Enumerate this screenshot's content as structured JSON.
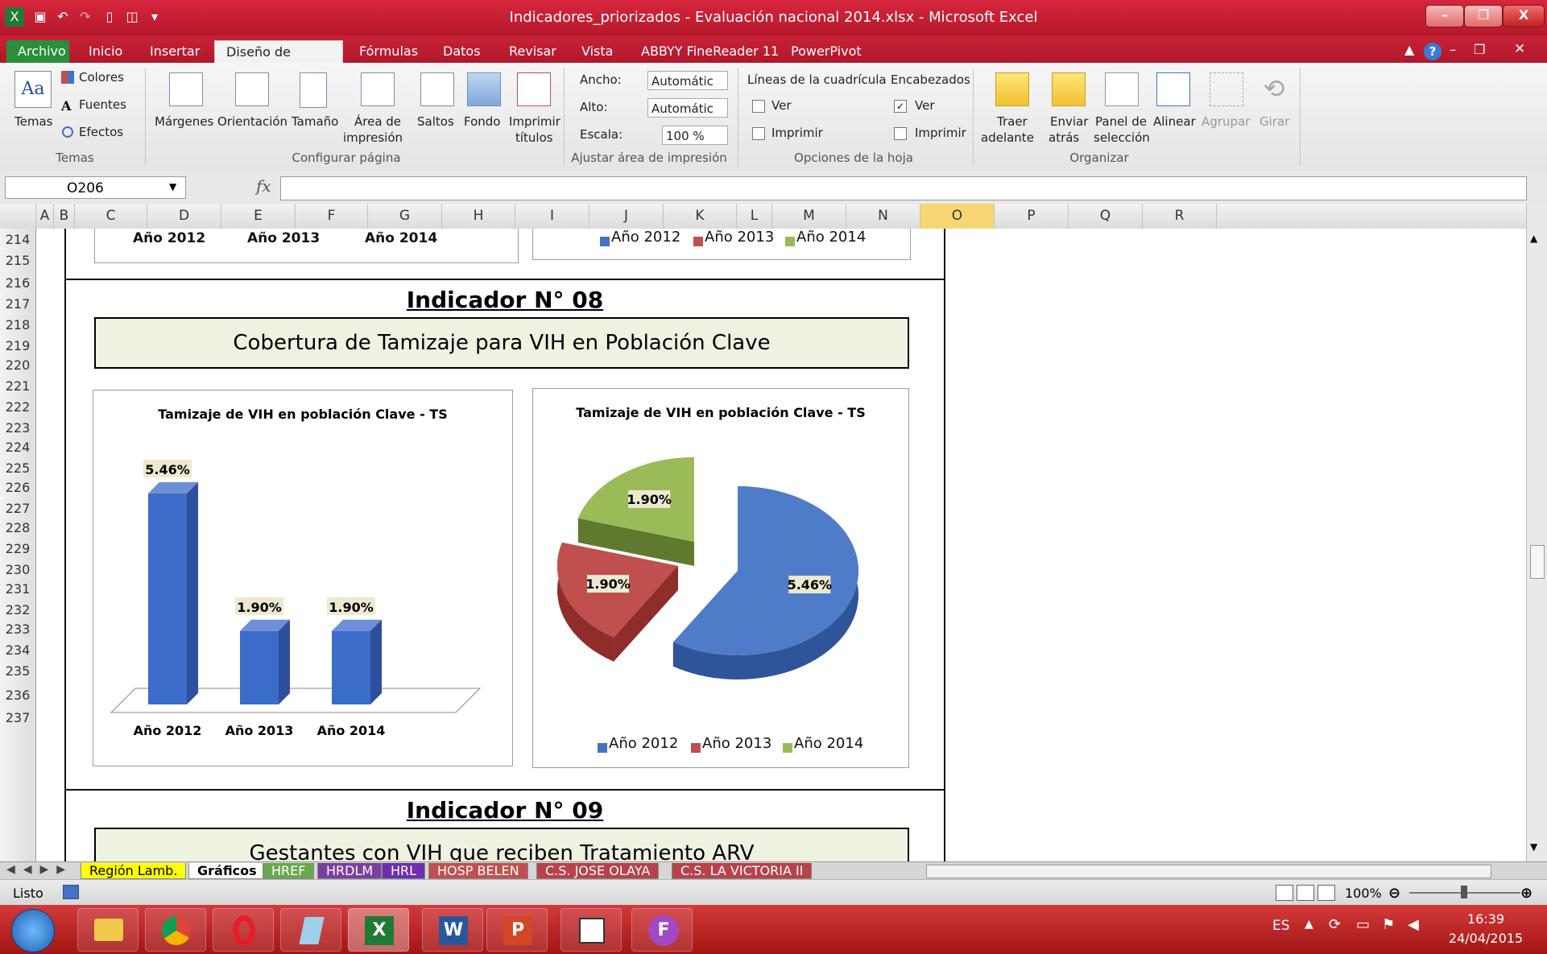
{
  "window": {
    "title": "Indicadores_priorizados - Evaluación nacional 2014.xlsx - Microsoft Excel",
    "min_glyph": "–",
    "max_glyph": "❐",
    "close_glyph": "X"
  },
  "ribbon_tabs": [
    "Archivo",
    "Inicio",
    "Insertar",
    "Diseño de página",
    "Fórmulas",
    "Datos",
    "Revisar",
    "Vista",
    "ABBYY FineReader 11",
    "PowerPivot"
  ],
  "ribbon": {
    "temas": {
      "themes_label": "Temas",
      "colores": "Colores",
      "fuentes": "Fuentes",
      "efectos": "Efectos",
      "group": "Temas"
    },
    "configurar": {
      "margenes": "Márgenes",
      "orientacion": "Orientación",
      "tamano": "Tamaño",
      "area_l1": "Área de",
      "area_l2": "impresión",
      "saltos": "Saltos",
      "fondo": "Fondo",
      "imprimir_l1": "Imprimir",
      "imprimir_l2": "títulos",
      "group": "Configurar página"
    },
    "ajustar": {
      "ancho_label": "Ancho:",
      "ancho_value": "Automátic",
      "alto_label": "Alto:",
      "alto_value": "Automátic",
      "escala_label": "Escala:",
      "escala_value": "100 %",
      "group": "Ajustar área de impresión"
    },
    "opciones": {
      "lineas": "Líneas de la cuadrícula",
      "encabezados": "Encabezados",
      "ver": "Ver",
      "imprimir": "Imprimir",
      "group": "Opciones de la hoja"
    },
    "organizar": {
      "traer_l1": "Traer",
      "traer_l2": "adelante",
      "enviar_l1": "Enviar",
      "enviar_l2": "atrás",
      "panel_l1": "Panel de",
      "panel_l2": "selección",
      "alinear": "Alinear",
      "agrupar": "Agrupar",
      "girar": "Girar",
      "group": "Organizar"
    }
  },
  "formula_bar": {
    "name_box": "O206",
    "fx": "fx",
    "formula": ""
  },
  "columns": [
    "A",
    "B",
    "C",
    "D",
    "E",
    "F",
    "G",
    "H",
    "I",
    "J",
    "K",
    "L",
    "M",
    "N",
    "O",
    "P",
    "Q",
    "R"
  ],
  "rows": [
    "214",
    "215",
    "216",
    "217",
    "218",
    "219",
    "220",
    "221",
    "222",
    "223",
    "224",
    "225",
    "226",
    "227",
    "228",
    "229",
    "230",
    "231",
    "232",
    "233",
    "234",
    "235",
    "236",
    "237"
  ],
  "top_remnants": {
    "left_labels": [
      "Año 2012",
      "Año 2013",
      "Año 2014"
    ],
    "legend": [
      "Año 2012",
      "Año 2013",
      "Año 2014"
    ]
  },
  "indicador_08": {
    "heading": "Indicador N° 08",
    "title": "Cobertura de Tamizaje para VIH en Población Clave"
  },
  "indicador_09": {
    "heading": "Indicador N° 09",
    "title": "Gestantes con VIH  que reciben Tratamiento ARV"
  },
  "colors": {
    "blue": "#4472c4",
    "red": "#c0504d",
    "green": "#9bbb59",
    "title_bg": "#eef2e0",
    "excel_red": "#c21f32"
  },
  "chart_data": [
    {
      "type": "bar",
      "title": "Tamizaje de VIH en  población Clave - TS",
      "categories": [
        "Año 2012",
        "Año 2013",
        "Año 2014"
      ],
      "values": [
        5.46,
        1.9,
        1.9
      ],
      "labels": [
        "5.46%",
        "1.90%",
        "1.90%"
      ],
      "units": "%",
      "ylim": [
        0,
        6
      ],
      "grid": false,
      "style": "3d-columns"
    },
    {
      "type": "pie",
      "title": "Tamizaje de VIH en  población Clave - TS",
      "categories": [
        "Año 2012",
        "Año 2013",
        "Año 2014"
      ],
      "values": [
        5.46,
        1.9,
        1.9
      ],
      "labels": [
        "5.46%",
        "1.90%",
        "1.90%"
      ],
      "legend": "bottom",
      "style": "3d-exploded"
    }
  ],
  "sheet_tabs": [
    "Región Lamb.",
    "Gráficos",
    "HREF",
    "HRDLM",
    "HRL",
    "HOSP BELEN",
    "C.S. JOSE OLAYA",
    "C.S. LA VICTORIA II"
  ],
  "status": {
    "ready": "Listo",
    "zoom": "100%"
  },
  "taskbar": {
    "lang": "ES",
    "time": "16:39",
    "date": "24/04/2015"
  }
}
